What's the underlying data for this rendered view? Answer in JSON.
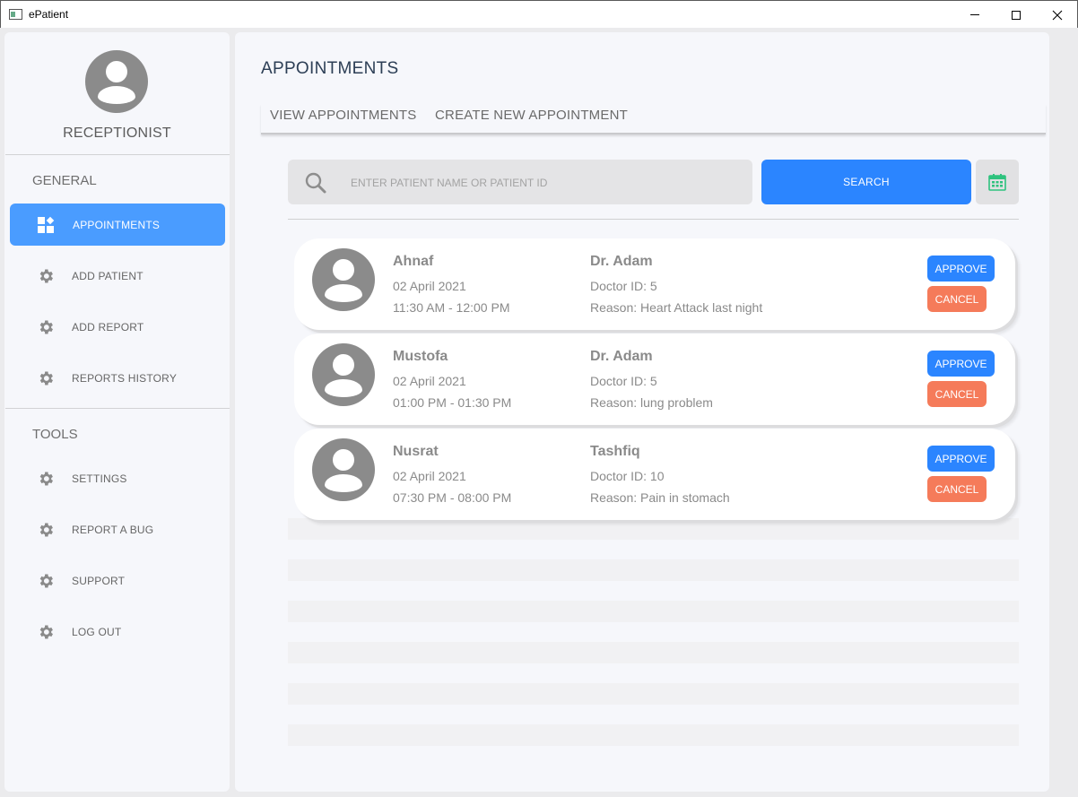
{
  "window": {
    "title": "ePatient"
  },
  "sidebar": {
    "role": "RECEPTIONIST",
    "general_label": "GENERAL",
    "tools_label": "TOOLS",
    "general_items": [
      {
        "label": "APPOINTMENTS",
        "icon": "dashboard-icon",
        "active": true
      },
      {
        "label": "ADD PATIENT",
        "icon": "gear-icon"
      },
      {
        "label": "ADD REPORT",
        "icon": "gear-icon"
      },
      {
        "label": "REPORTS HISTORY",
        "icon": "gear-icon"
      }
    ],
    "tool_items": [
      {
        "label": "SETTINGS",
        "icon": "gear-icon"
      },
      {
        "label": "REPORT A BUG",
        "icon": "gear-icon"
      },
      {
        "label": "SUPPORT",
        "icon": "gear-icon"
      },
      {
        "label": "LOG OUT",
        "icon": "gear-icon"
      }
    ]
  },
  "main": {
    "title": "APPOINTMENTS",
    "tabs": [
      {
        "label": "VIEW APPOINTMENTS"
      },
      {
        "label": "CREATE NEW APPOINTMENT"
      }
    ],
    "search": {
      "placeholder": "ENTER PATIENT NAME OR PATIENT ID",
      "value": "",
      "button_label": "SEARCH"
    },
    "appointments": [
      {
        "patient": "Ahnaf",
        "date": "02 April 2021",
        "time": "11:30 AM - 12:00 PM",
        "doctor": "Dr. Adam",
        "doctor_id": "Doctor ID: 5",
        "reason": "Reason: Heart Attack last night",
        "approve": "APPROVE",
        "cancel": "CANCEL"
      },
      {
        "patient": "Mustofa",
        "date": "02 April 2021",
        "time": "01:00 PM - 01:30 PM",
        "doctor": "Dr. Adam",
        "doctor_id": "Doctor ID: 5",
        "reason": "Reason: lung problem",
        "approve": "APPROVE",
        "cancel": "CANCEL"
      },
      {
        "patient": "Nusrat",
        "date": "02 April 2021",
        "time": "07:30 PM - 08:00 PM",
        "doctor": "Tashfiq",
        "doctor_id": "Doctor ID: 10",
        "reason": "Reason: Pain in stomach",
        "approve": "APPROVE",
        "cancel": "CANCEL"
      }
    ]
  },
  "colors": {
    "accent": "#2b85ff",
    "active_nav": "#4a9cff",
    "cancel": "#f57b5a",
    "calendar_icon": "#2ec27e"
  }
}
